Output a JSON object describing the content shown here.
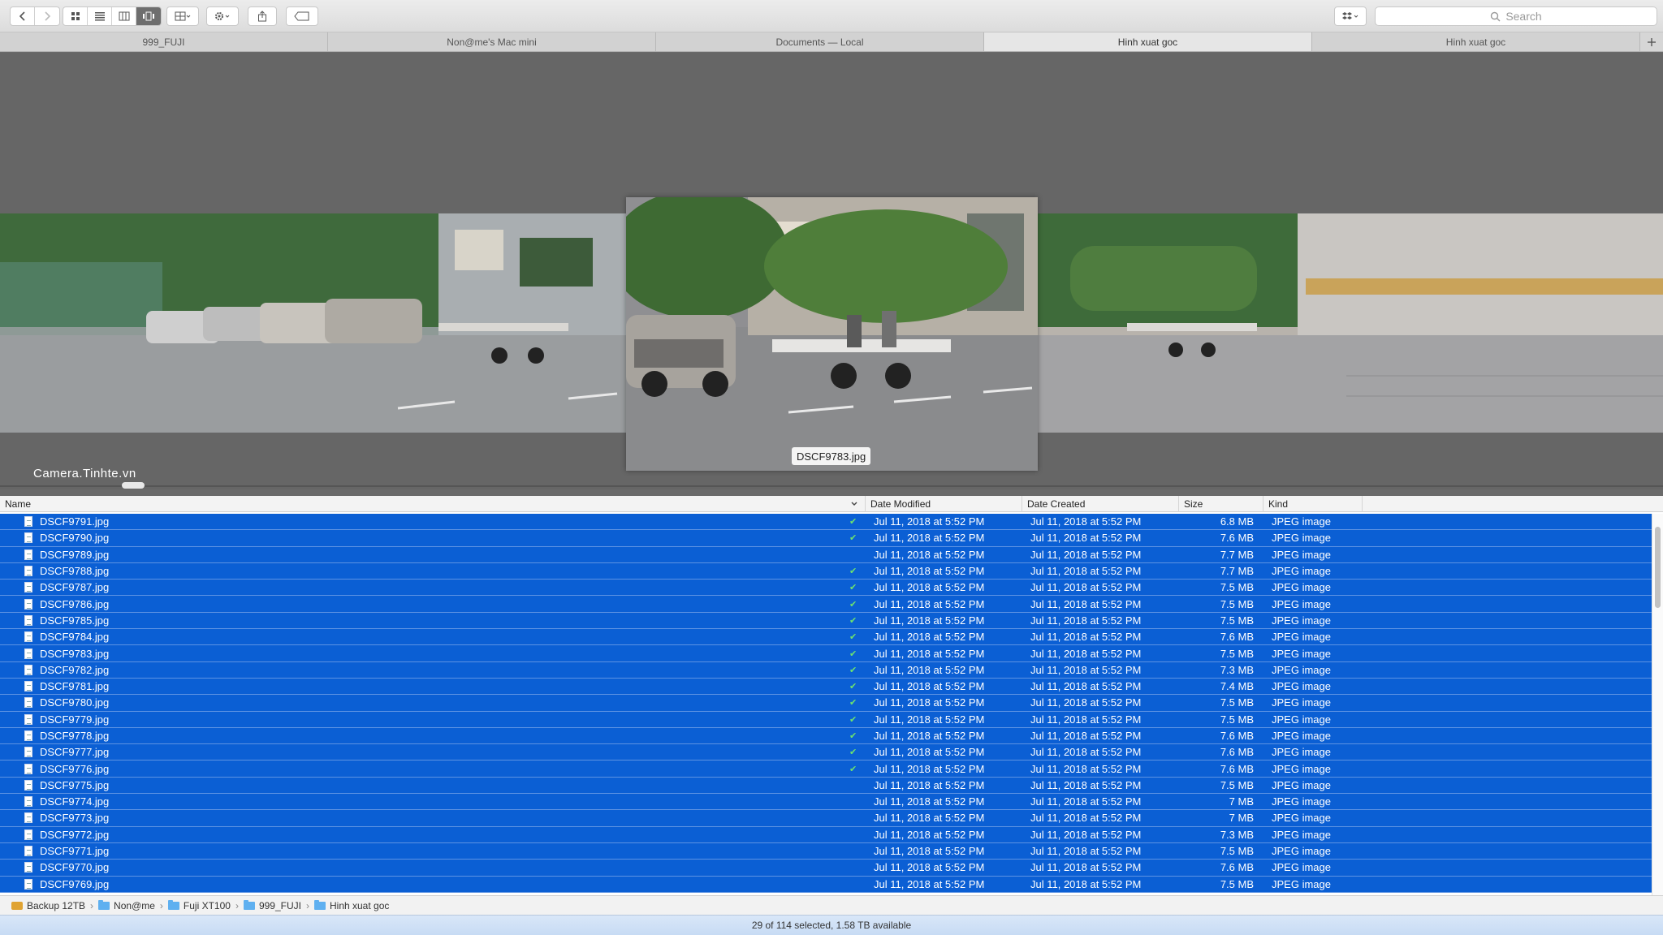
{
  "toolbar": {
    "back_icon": "chevron-left-icon",
    "forward_icon": "chevron-right-icon",
    "search_placeholder": "Search"
  },
  "tabs": [
    {
      "label": "999_FUJI",
      "active": false
    },
    {
      "label": "Non@me's Mac mini",
      "active": false
    },
    {
      "label": "Documents — Local",
      "active": false
    },
    {
      "label": "Hinh xuat goc",
      "active": true
    },
    {
      "label": "Hinh xuat goc",
      "active": false
    }
  ],
  "coverflow": {
    "selected_label": "DSCF9783.jpg",
    "watermark": "Camera.Tinhte.vn"
  },
  "columns": {
    "name": "Name",
    "date_modified": "Date Modified",
    "date_created": "Date Created",
    "size": "Size",
    "kind": "Kind"
  },
  "files": [
    {
      "name": "DSCF9791.jpg",
      "check": "✔",
      "modified": "Jul 11, 2018 at 5:52 PM",
      "created": "Jul 11, 2018 at 5:52 PM",
      "size": "6.8 MB",
      "kind": "JPEG image"
    },
    {
      "name": "DSCF9790.jpg",
      "check": "✔",
      "modified": "Jul 11, 2018 at 5:52 PM",
      "created": "Jul 11, 2018 at 5:52 PM",
      "size": "7.6 MB",
      "kind": "JPEG image"
    },
    {
      "name": "DSCF9789.jpg",
      "check": "",
      "modified": "Jul 11, 2018 at 5:52 PM",
      "created": "Jul 11, 2018 at 5:52 PM",
      "size": "7.7 MB",
      "kind": "JPEG image"
    },
    {
      "name": "DSCF9788.jpg",
      "check": "✔",
      "modified": "Jul 11, 2018 at 5:52 PM",
      "created": "Jul 11, 2018 at 5:52 PM",
      "size": "7.7 MB",
      "kind": "JPEG image"
    },
    {
      "name": "DSCF9787.jpg",
      "check": "✔",
      "modified": "Jul 11, 2018 at 5:52 PM",
      "created": "Jul 11, 2018 at 5:52 PM",
      "size": "7.5 MB",
      "kind": "JPEG image"
    },
    {
      "name": "DSCF9786.jpg",
      "check": "✔",
      "modified": "Jul 11, 2018 at 5:52 PM",
      "created": "Jul 11, 2018 at 5:52 PM",
      "size": "7.5 MB",
      "kind": "JPEG image"
    },
    {
      "name": "DSCF9785.jpg",
      "check": "✔",
      "modified": "Jul 11, 2018 at 5:52 PM",
      "created": "Jul 11, 2018 at 5:52 PM",
      "size": "7.5 MB",
      "kind": "JPEG image"
    },
    {
      "name": "DSCF9784.jpg",
      "check": "✔",
      "modified": "Jul 11, 2018 at 5:52 PM",
      "created": "Jul 11, 2018 at 5:52 PM",
      "size": "7.6 MB",
      "kind": "JPEG image"
    },
    {
      "name": "DSCF9783.jpg",
      "check": "✔",
      "modified": "Jul 11, 2018 at 5:52 PM",
      "created": "Jul 11, 2018 at 5:52 PM",
      "size": "7.5 MB",
      "kind": "JPEG image"
    },
    {
      "name": "DSCF9782.jpg",
      "check": "✔",
      "modified": "Jul 11, 2018 at 5:52 PM",
      "created": "Jul 11, 2018 at 5:52 PM",
      "size": "7.3 MB",
      "kind": "JPEG image"
    },
    {
      "name": "DSCF9781.jpg",
      "check": "✔",
      "modified": "Jul 11, 2018 at 5:52 PM",
      "created": "Jul 11, 2018 at 5:52 PM",
      "size": "7.4 MB",
      "kind": "JPEG image"
    },
    {
      "name": "DSCF9780.jpg",
      "check": "✔",
      "modified": "Jul 11, 2018 at 5:52 PM",
      "created": "Jul 11, 2018 at 5:52 PM",
      "size": "7.5 MB",
      "kind": "JPEG image"
    },
    {
      "name": "DSCF9779.jpg",
      "check": "✔",
      "modified": "Jul 11, 2018 at 5:52 PM",
      "created": "Jul 11, 2018 at 5:52 PM",
      "size": "7.5 MB",
      "kind": "JPEG image"
    },
    {
      "name": "DSCF9778.jpg",
      "check": "✔",
      "modified": "Jul 11, 2018 at 5:52 PM",
      "created": "Jul 11, 2018 at 5:52 PM",
      "size": "7.6 MB",
      "kind": "JPEG image"
    },
    {
      "name": "DSCF9777.jpg",
      "check": "✔",
      "modified": "Jul 11, 2018 at 5:52 PM",
      "created": "Jul 11, 2018 at 5:52 PM",
      "size": "7.6 MB",
      "kind": "JPEG image"
    },
    {
      "name": "DSCF9776.jpg",
      "check": "✔",
      "modified": "Jul 11, 2018 at 5:52 PM",
      "created": "Jul 11, 2018 at 5:52 PM",
      "size": "7.6 MB",
      "kind": "JPEG image"
    },
    {
      "name": "DSCF9775.jpg",
      "check": "",
      "modified": "Jul 11, 2018 at 5:52 PM",
      "created": "Jul 11, 2018 at 5:52 PM",
      "size": "7.5 MB",
      "kind": "JPEG image"
    },
    {
      "name": "DSCF9774.jpg",
      "check": "",
      "modified": "Jul 11, 2018 at 5:52 PM",
      "created": "Jul 11, 2018 at 5:52 PM",
      "size": "7 MB",
      "kind": "JPEG image"
    },
    {
      "name": "DSCF9773.jpg",
      "check": "",
      "modified": "Jul 11, 2018 at 5:52 PM",
      "created": "Jul 11, 2018 at 5:52 PM",
      "size": "7 MB",
      "kind": "JPEG image"
    },
    {
      "name": "DSCF9772.jpg",
      "check": "",
      "modified": "Jul 11, 2018 at 5:52 PM",
      "created": "Jul 11, 2018 at 5:52 PM",
      "size": "7.3 MB",
      "kind": "JPEG image"
    },
    {
      "name": "DSCF9771.jpg",
      "check": "",
      "modified": "Jul 11, 2018 at 5:52 PM",
      "created": "Jul 11, 2018 at 5:52 PM",
      "size": "7.5 MB",
      "kind": "JPEG image"
    },
    {
      "name": "DSCF9770.jpg",
      "check": "",
      "modified": "Jul 11, 2018 at 5:52 PM",
      "created": "Jul 11, 2018 at 5:52 PM",
      "size": "7.6 MB",
      "kind": "JPEG image"
    },
    {
      "name": "DSCF9769.jpg",
      "check": "",
      "modified": "Jul 11, 2018 at 5:52 PM",
      "created": "Jul 11, 2018 at 5:52 PM",
      "size": "7.5 MB",
      "kind": "JPEG image"
    }
  ],
  "pathbar": [
    {
      "label": "Backup 12TB",
      "icon": "drive-icon"
    },
    {
      "label": "Non@me",
      "icon": "folder-icon"
    },
    {
      "label": "Fuji XT100",
      "icon": "folder-icon"
    },
    {
      "label": "999_FUJI",
      "icon": "folder-icon"
    },
    {
      "label": "Hinh xuat goc",
      "icon": "folder-icon"
    }
  ],
  "status": "29 of 114 selected, 1.58 TB available",
  "colors": {
    "selection": "#0b5fd4",
    "checkmark": "#6ee36e",
    "status_bar": "#c7dbf4"
  }
}
